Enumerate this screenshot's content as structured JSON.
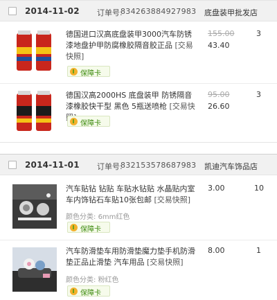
{
  "orders": [
    {
      "date": "2014-11-02",
      "order_label": "订单号:",
      "order_no": "834263884927983",
      "shop": "底盘装甲批发店",
      "items": [
        {
          "title": "德国进口汉高底盘装甲3000汽车防锈漆地盘护甲防腐橡胶隔音胶正品",
          "snapshot": "[交易快照]",
          "badge": "保障卡",
          "price_old": "155.00",
          "price": "43.40",
          "qty": "3",
          "thumb_colors": [
            "#c8261c",
            "#1e4f9c",
            "#f4c316"
          ]
        },
        {
          "title": "德国汉高2000HS 底盘装甲 防锈隔音漆橡胶快干型 黑色 5瓶送喷枪",
          "snapshot": "[交易快照]",
          "badge": "保障卡",
          "price_old": "95.00",
          "price": "26.60",
          "qty": "3",
          "thumb_colors": [
            "#c8261c",
            "#1b1b1b",
            "#f4c316"
          ]
        }
      ]
    },
    {
      "date": "2014-11-01",
      "order_label": "订单号:",
      "order_no": "832153578687983",
      "shop": "凯迪汽车饰品店",
      "items": [
        {
          "title": "汽车贴钻 钻贴 车贴水钻贴 水晶贴内室车内饰钻石车贴10张包邮",
          "snapshot": "[交易快照]",
          "attr_label": "颜色分类:",
          "attr_value": "6mm红色",
          "badge": "保障卡",
          "price": "3.00",
          "qty": "10",
          "thumb_colors": [
            "#2a2a2a",
            "#c9c9c9",
            "#e8e8e8"
          ]
        },
        {
          "title": "汽车防滑垫车用防滑垫魔力垫手机防滑垫正品止滑垫 汽车用品",
          "snapshot": "[交易快照]",
          "attr_label": "颜色分类:",
          "attr_value": "粉红色",
          "badge": "保障卡",
          "price": "8.00",
          "qty": "1",
          "thumb_colors": [
            "#3a3a3a",
            "#e89bb5",
            "#7aa0c8"
          ]
        }
      ]
    }
  ]
}
